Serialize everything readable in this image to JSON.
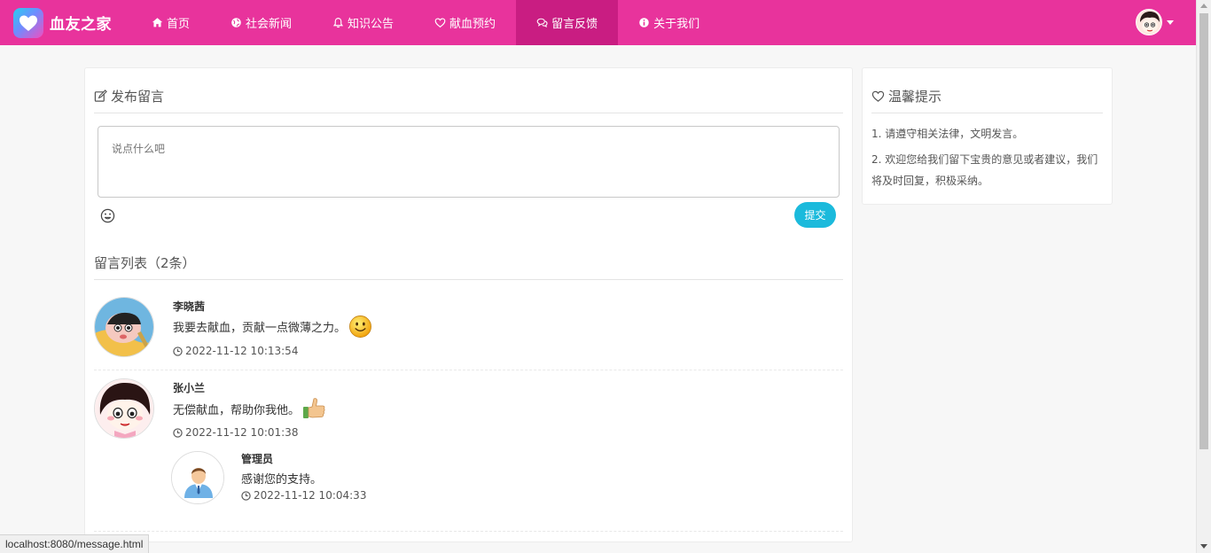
{
  "brand": {
    "name": "血友之家"
  },
  "nav": {
    "items": [
      {
        "label": "首页",
        "icon": "home-icon"
      },
      {
        "label": "社会新闻",
        "icon": "globe-icon"
      },
      {
        "label": "知识公告",
        "icon": "bell-icon"
      },
      {
        "label": "献血预约",
        "icon": "heart-icon"
      },
      {
        "label": "留言反馈",
        "icon": "comments-icon",
        "active": true
      },
      {
        "label": "关于我们",
        "icon": "info-icon"
      }
    ]
  },
  "post": {
    "title": "发布留言",
    "placeholder": "说点什么吧",
    "submit_label": "提交"
  },
  "list": {
    "title": "留言列表（2条）",
    "messages": [
      {
        "name": "李晓茜",
        "content": "我要去献血，贡献一点微薄之力。",
        "time": "2022-11-12 10:13:54",
        "emoji": "smile"
      },
      {
        "name": "张小兰",
        "content": "无偿献血，帮助你我他。",
        "time": "2022-11-12 10:01:38",
        "emoji": "thumbs-up",
        "reply": {
          "name": "管理员",
          "content": "感谢您的支持。",
          "time": "2022-11-12 10:04:33"
        }
      }
    ]
  },
  "tips": {
    "title": "温馨提示",
    "items": [
      "1. 请遵守相关法律，文明发言。",
      "2. 欢迎您给我们留下宝贵的意见或者建议，我们将及时回复，积极采纳。"
    ]
  },
  "status": {
    "url": "localhost:8080/message.html"
  },
  "colors": {
    "primary": "#e8339c",
    "active": "#c91d82",
    "button": "#1bbadc"
  }
}
